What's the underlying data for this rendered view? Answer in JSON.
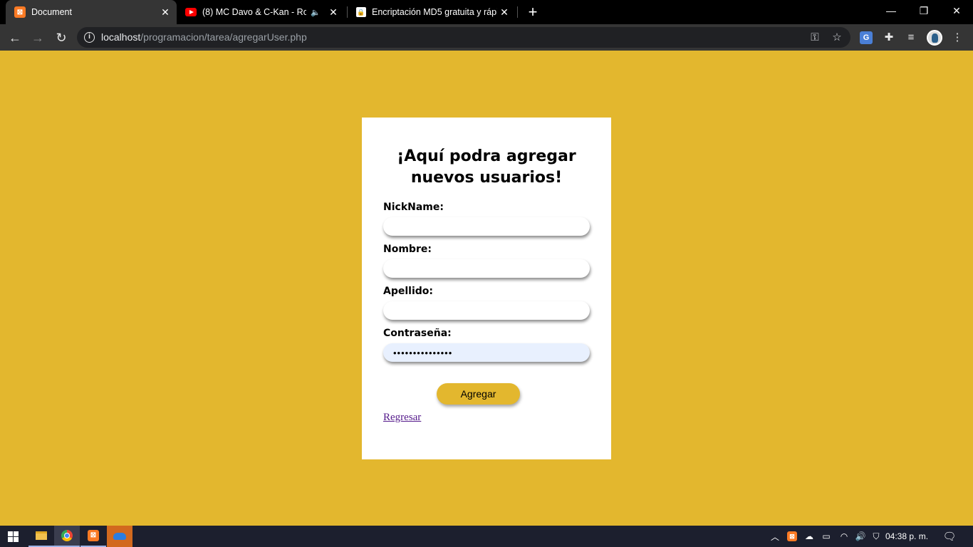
{
  "browser": {
    "tabs": [
      {
        "title": "Document",
        "favicon": "xampp-icon",
        "active": true
      },
      {
        "title": "(8) MC Davo & C-Kan - Roun",
        "favicon": "youtube-icon",
        "active": false,
        "audio": true
      },
      {
        "title": "Encriptación MD5 gratuita y rápi",
        "favicon": "lock-icon",
        "active": false
      }
    ],
    "url_host": "localhost",
    "url_path": "/programacion/tarea/agregarUser.php"
  },
  "page": {
    "heading": "¡Aquí podra agregar nuevos usuarios!",
    "fields": {
      "nickname_label": "NickName:",
      "nickname_value": "",
      "nombre_label": "Nombre:",
      "nombre_value": "",
      "apellido_label": "Apellido:",
      "apellido_value": "",
      "password_label": "Contraseña:",
      "password_value": "•••••••••••••••"
    },
    "submit_label": "Agregar",
    "back_link": "Regresar",
    "colors": {
      "background": "#e3b72e",
      "card": "#ffffff",
      "button": "#e3b72e",
      "autofill": "#e8f0fe",
      "link": "#551a8b"
    }
  },
  "taskbar": {
    "clock": "04:38 p. m."
  }
}
